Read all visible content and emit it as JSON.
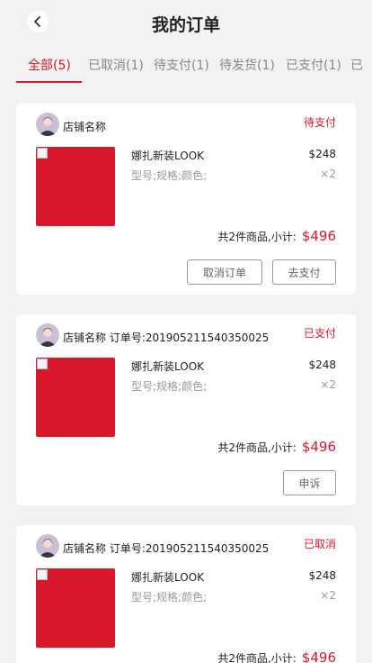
{
  "header": {
    "title": "我的订单"
  },
  "tabs": [
    {
      "label": "全部(5)"
    },
    {
      "label": "已取消(1)"
    },
    {
      "label": "待支付(1)"
    },
    {
      "label": "待发货(1)"
    },
    {
      "label": "已支付(1)"
    },
    {
      "label": "已"
    }
  ],
  "orders": [
    {
      "shop": "店铺名称",
      "status": "待支付",
      "product": {
        "name": "娜扎新装LOOK",
        "spec": "型号;规格;颜色;",
        "price": "$248",
        "qty": "×2"
      },
      "summary": {
        "label": "共2件商品,小计:",
        "amount": "$496"
      },
      "buttons": [
        "取消订单",
        "去支付"
      ]
    },
    {
      "shop": "店铺名称 订单号:201905211540350025",
      "status": "已支付",
      "product": {
        "name": "娜扎新装LOOK",
        "spec": "型号;规格;颜色;",
        "price": "$248",
        "qty": "×2"
      },
      "summary": {
        "label": "共2件商品,小计:",
        "amount": "$496"
      },
      "buttons": [
        "申诉"
      ]
    },
    {
      "shop": "店铺名称 订单号:201905211540350025",
      "status": "已取消",
      "product": {
        "name": "娜扎新装LOOK",
        "spec": "型号;规格;颜色;",
        "price": "$248",
        "qty": "×2"
      },
      "summary": {
        "label": "共2件商品,小计:",
        "amount": "$496"
      },
      "buttons": []
    }
  ],
  "colors": {
    "accent": "#d9182b",
    "background": "#f2f2f2"
  },
  "icons": {
    "back": "chevron-left-icon"
  }
}
